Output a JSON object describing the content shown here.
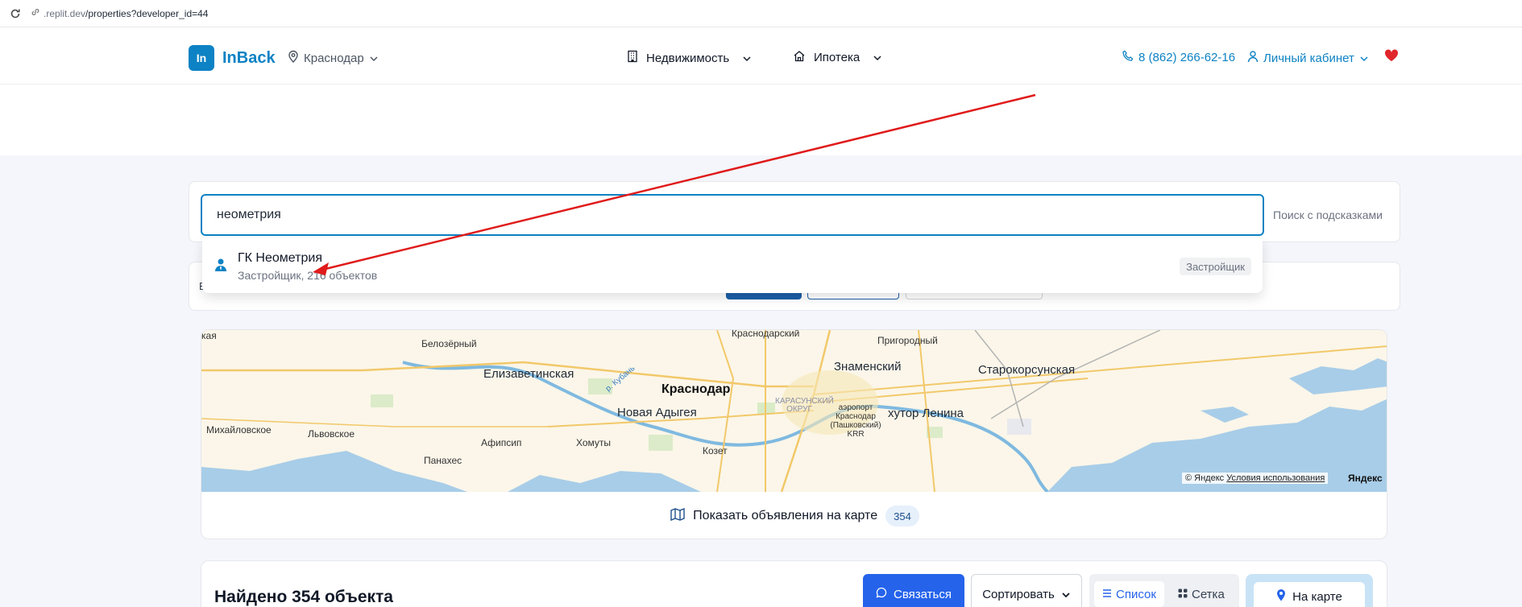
{
  "browser": {
    "url_host": ".replit.dev",
    "url_path": "/properties?developer_id=44"
  },
  "header": {
    "logo_mark": "In",
    "logo_name": "InBack",
    "city": "Краснодар",
    "nav_realty": "Недвижимость",
    "nav_mortgage": "Ипотека",
    "phone": "8 (862) 266-62-16",
    "cabinet": "Личный кабинет"
  },
  "search": {
    "value": "неометрия",
    "hint": "Поиск с подсказками"
  },
  "filters": {
    "fragment": "В"
  },
  "suggestion": {
    "title": "ГК Неометрия",
    "subtitle": "Застройщик, 216 объектов",
    "tag": "Застройщик"
  },
  "map": {
    "labels": {
      "krasnodar": "Краснодар",
      "elizavetinskaya": "Елизаветинская",
      "novaya_adygeya": "Новая Адыгея",
      "znamensky": "Знаменский",
      "starokorsunskaya": "Старокорсунская",
      "khutor_lenina": "хутор Ленина",
      "mikhailovskoe": "Михайловское",
      "lvovskoe": "Львовское",
      "afipsip": "Афипсип",
      "khomuty": "Хомуты",
      "kozet": "Козет",
      "panakhes": "Панахес",
      "belozyorny": "Белозёрный",
      "prigorodny": "Пригородный",
      "krasnodarskiy": "Краснодарский",
      "karasunsky": "КАРАСУНСКИЙ ОКРУГ",
      "airport": "аэропорт Краснодар (Пашковский) KRR",
      "kaya": "кая",
      "river": "р. Кубань"
    },
    "copyright": "© Яндекс",
    "terms": "Условия использования",
    "yandex": "Яндекс",
    "show_on_map": "Показать объявления на карте",
    "count": "354"
  },
  "results": {
    "title": "Найдено 354 объекта",
    "contact": "Связаться",
    "sort": "Сортировать",
    "view_list": "Список",
    "view_grid": "Сетка",
    "on_map": "На карте"
  },
  "colors": {
    "brand": "#0d82c4",
    "primary_button": "#2563eb",
    "annotation_arrow": "#e01b1b",
    "favorite": "#e0252b"
  }
}
